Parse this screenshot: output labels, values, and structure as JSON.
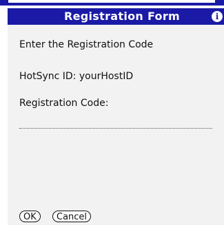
{
  "colors": {
    "title_bar": "#1a1aa6",
    "title_text": "#ffffff",
    "background": "#f2f2f2"
  },
  "form": {
    "title": "Registration Form",
    "info_icon": "i",
    "instruction": "Enter the Registration Code",
    "hotsync": {
      "label": "HotSync ID:",
      "value": "yourHostID"
    },
    "code_label": "Registration Code:",
    "code_value": ""
  },
  "buttons": {
    "ok": "OK",
    "cancel": "Cancel"
  },
  "icons": {
    "info": "info-icon"
  }
}
